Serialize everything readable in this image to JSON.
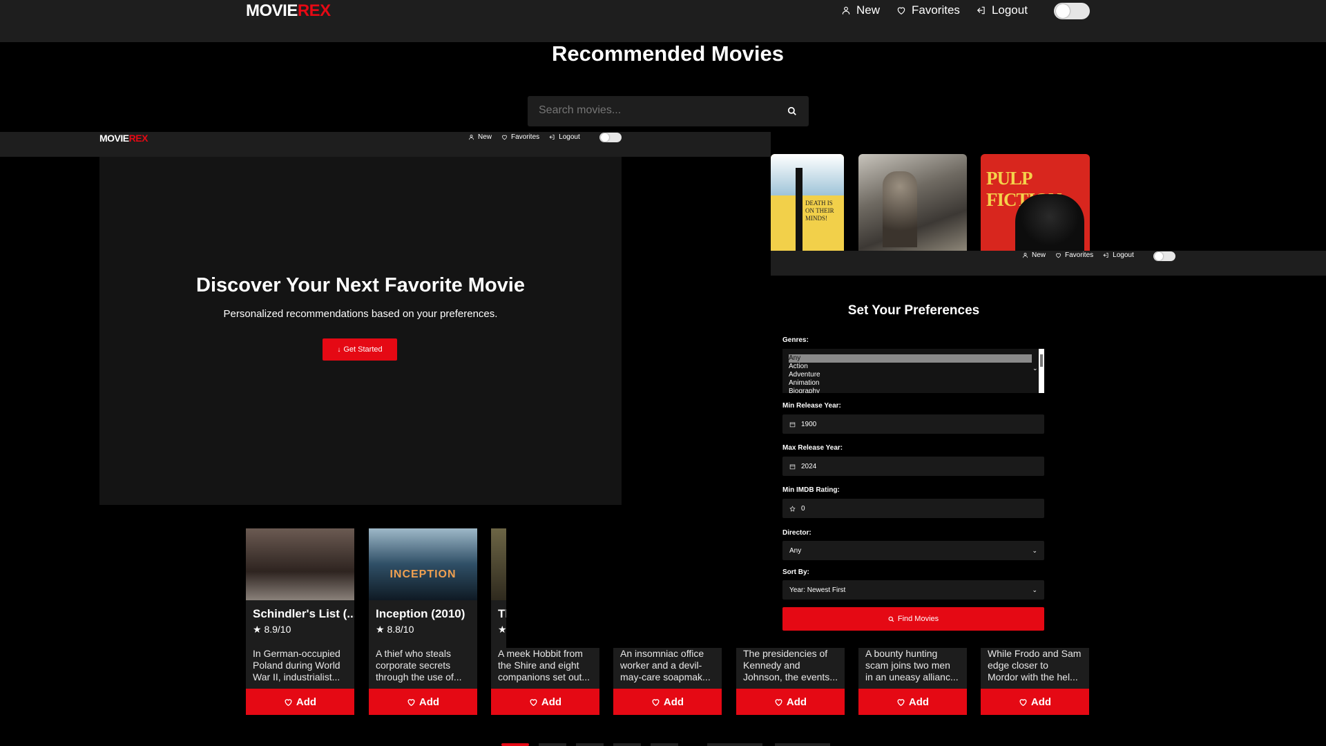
{
  "brand": {
    "name_left": "MOVIE",
    "name_right": "REX",
    "accent": "#e50914"
  },
  "nav": {
    "new_label": "New",
    "favorites_label": "Favorites",
    "logout_label": "Logout"
  },
  "page_title": "Recommended Movies",
  "search": {
    "placeholder": "Search movies..."
  },
  "hero": {
    "title": "Discover Your Next Favorite Movie",
    "subtitle": "Personalized recommendations based on your preferences.",
    "cta_label": "Get Started"
  },
  "posters": [
    {
      "name": "partial-poster",
      "text": "DEATH IS ON THEIR MINDS!"
    },
    {
      "name": "lotr-poster",
      "text": ""
    },
    {
      "name": "pulp-fiction-poster",
      "text": "PULP FICTION"
    }
  ],
  "preferences": {
    "title": "Set Your Preferences",
    "genres_label": "Genres:",
    "genres": [
      "Any",
      "Action",
      "Adventure",
      "Animation",
      "Biography"
    ],
    "min_year_label": "Min Release Year:",
    "min_year": "1900",
    "max_year_label": "Max Release Year:",
    "max_year": "2024",
    "min_rating_label": "Min IMDB Rating:",
    "min_rating": "0",
    "director_label": "Director:",
    "director": "Any",
    "sort_label": "Sort By:",
    "sort": "Year: Newest First",
    "find_label": "Find Movies"
  },
  "cards": [
    {
      "title": "Schindler's List (...",
      "rating": "8.9/10",
      "desc": [
        "In German-occupied",
        "Poland during World",
        "War II, industrialist..."
      ]
    },
    {
      "title": "Inception (2010)",
      "rating": "8.8/10",
      "poster_text": "INCEPTION",
      "desc": [
        "A thief who steals",
        "corporate secrets",
        "through the use of..."
      ]
    },
    {
      "title": "Tl",
      "rating": "",
      "desc": [
        "A meek Hobbit from",
        "the Shire and eight",
        "companions set out..."
      ]
    },
    {
      "title": "",
      "rating": "",
      "desc": [
        "An insomniac office",
        "worker and a devil-",
        "may-care soapmak..."
      ]
    },
    {
      "title": "",
      "rating": "",
      "desc": [
        "The presidencies of",
        "Kennedy and",
        "Johnson, the events..."
      ]
    },
    {
      "title": "",
      "rating": "",
      "desc": [
        "A bounty hunting",
        "scam joins two men",
        "in an uneasy allianc..."
      ]
    },
    {
      "title": "",
      "rating": "",
      "desc": [
        "While Frodo and Sam",
        "edge closer to",
        "Mordor with the hel..."
      ]
    }
  ],
  "add_label": "Add"
}
